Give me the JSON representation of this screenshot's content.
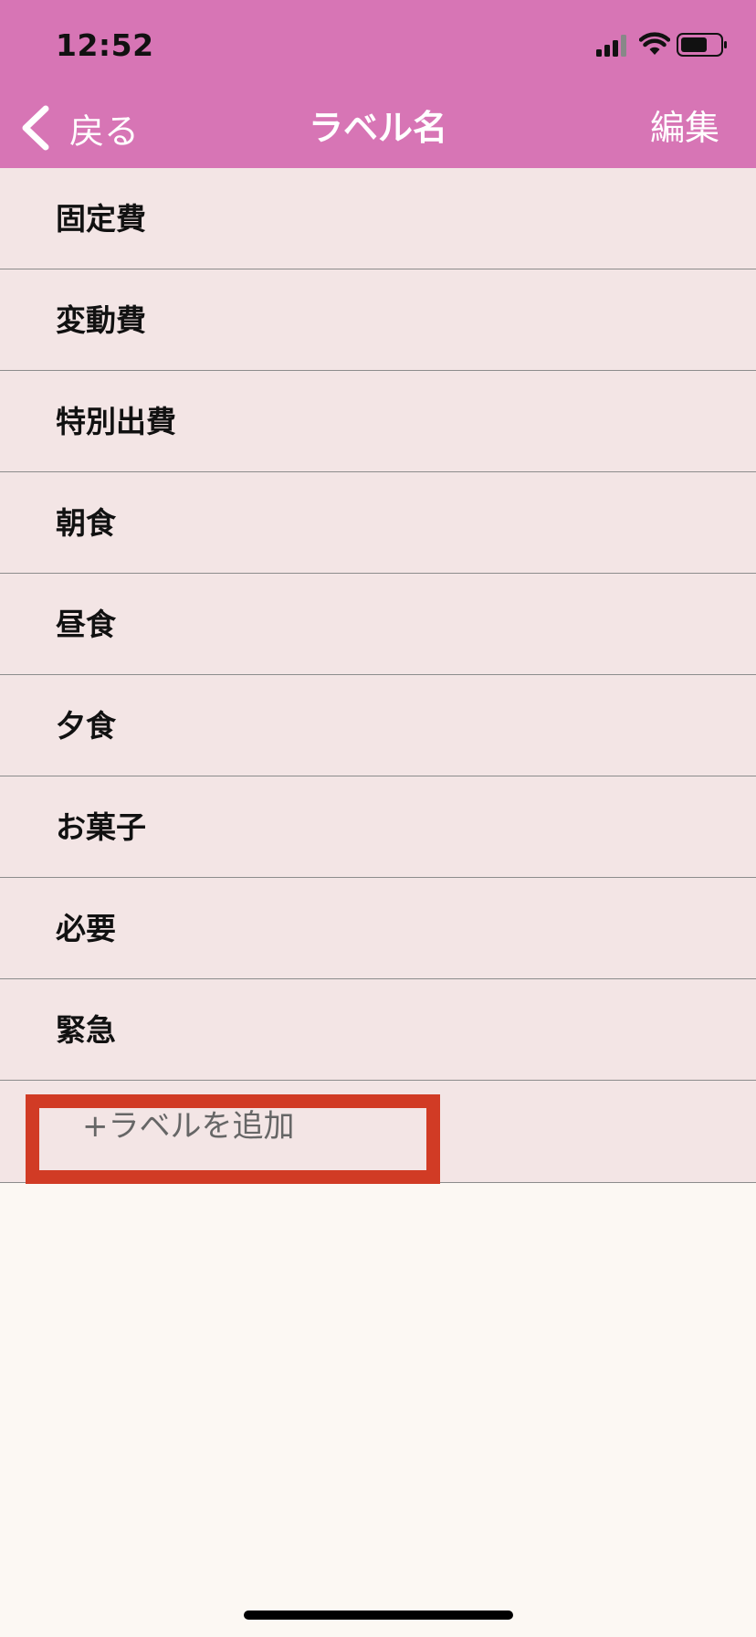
{
  "status_bar": {
    "time": "12:52"
  },
  "nav": {
    "back_label": "戻る",
    "title": "ラベル名",
    "edit_label": "編集"
  },
  "labels": [
    "固定費",
    "変動費",
    "特別出費",
    "朝食",
    "昼食",
    "夕食",
    "お菓子",
    "必要",
    "緊急"
  ],
  "add_button": {
    "label": "+ラベルを追加"
  },
  "colors": {
    "header": "#d775b5",
    "row_background": "#f3e5e5",
    "page_background": "#fcf8f3",
    "highlight": "#d13b25"
  },
  "icons": [
    "signal-icon",
    "wifi-icon",
    "battery-icon",
    "chevron-left-icon"
  ]
}
